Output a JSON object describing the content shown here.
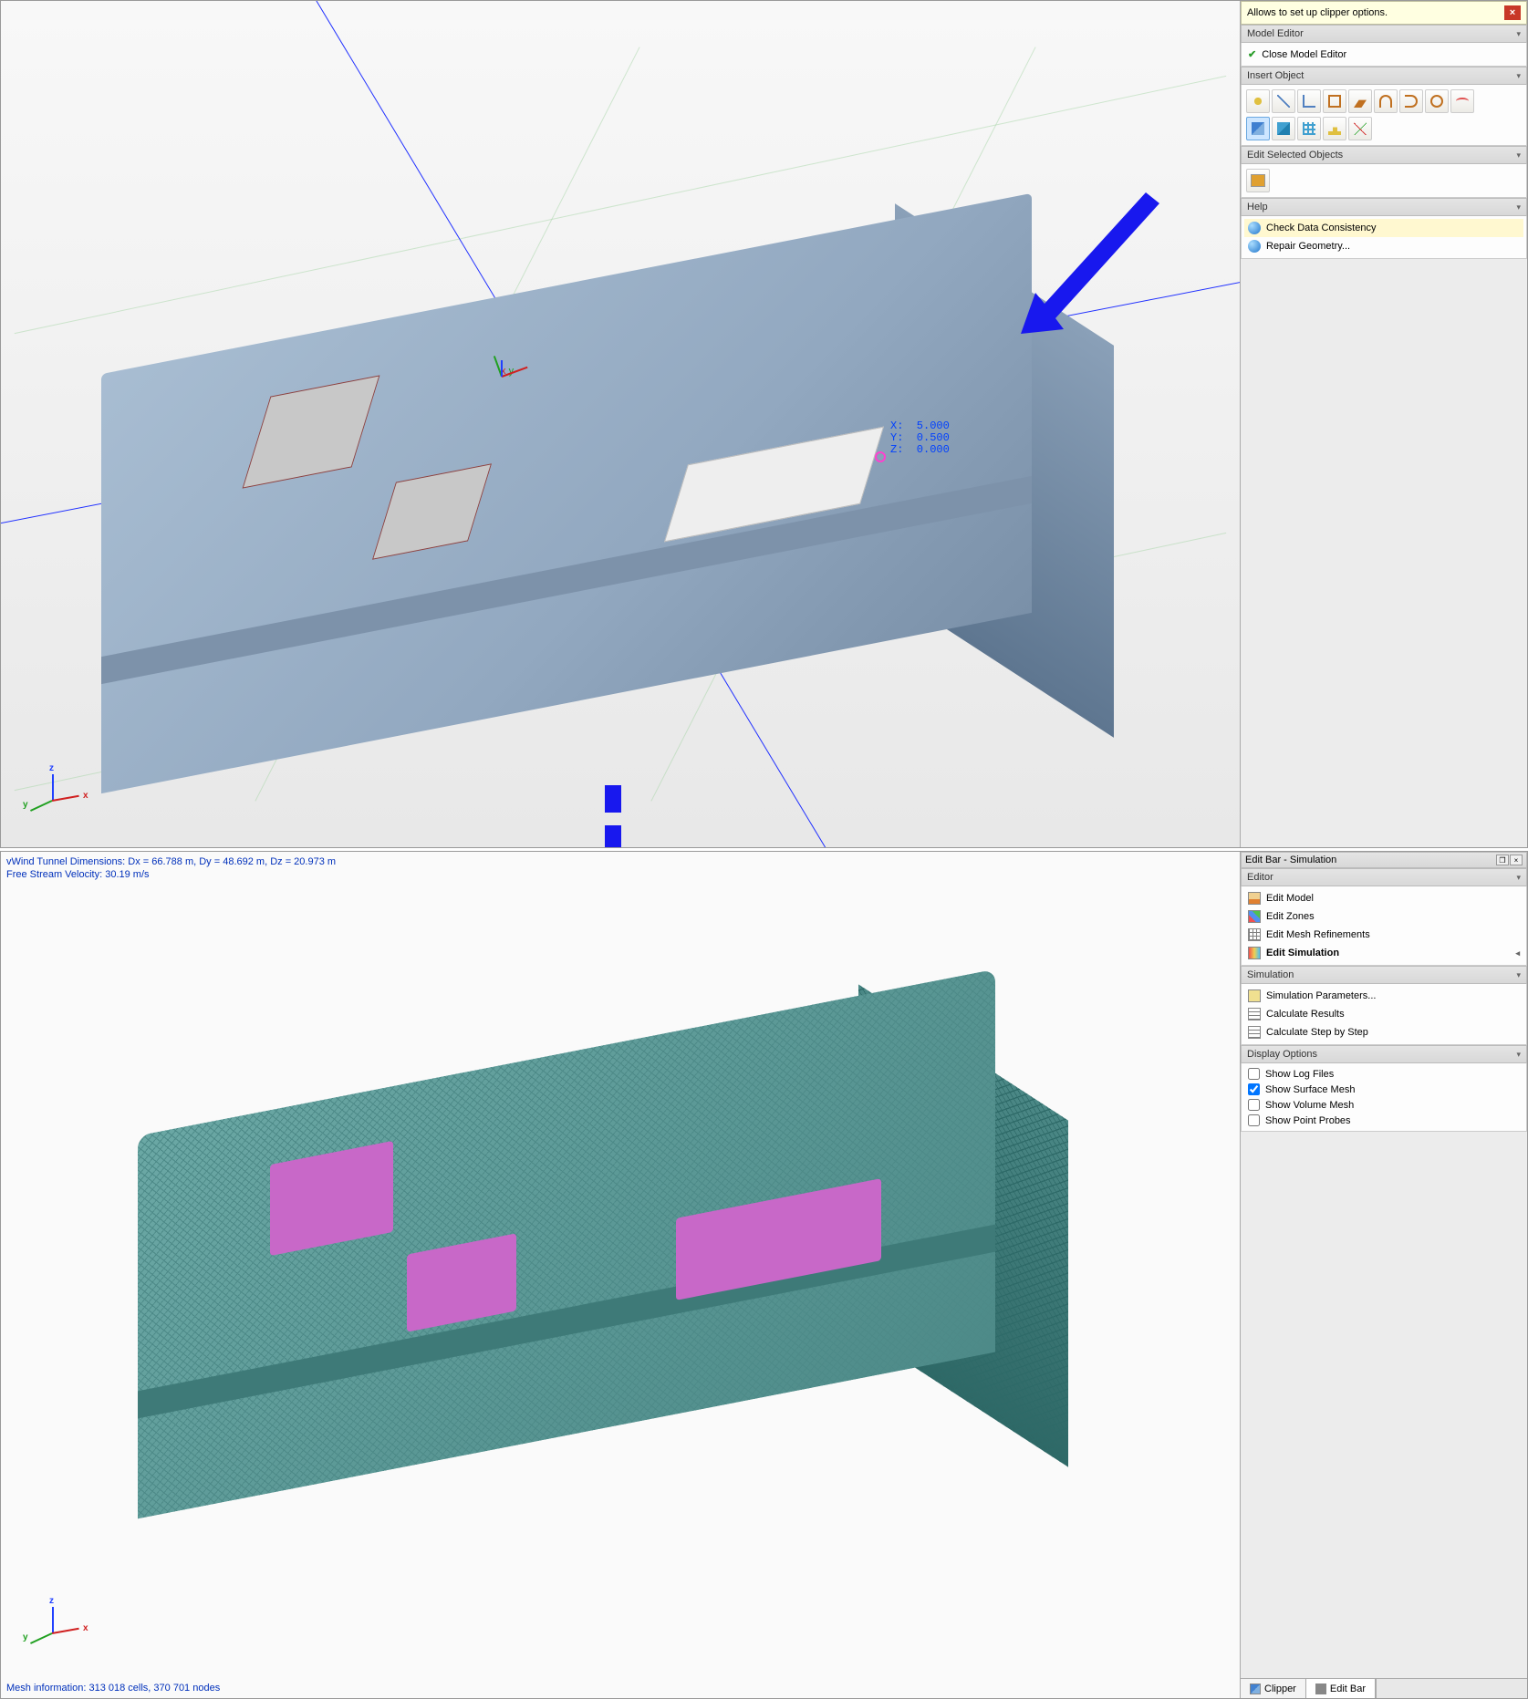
{
  "top": {
    "tooltip": "Allows to set up clipper options.",
    "panels": {
      "model_editor": {
        "title": "Model Editor",
        "close_label": "Close Model Editor"
      },
      "insert_object": {
        "title": "Insert Object"
      },
      "edit_selected": {
        "title": "Edit Selected Objects"
      },
      "help": {
        "title": "Help",
        "items": [
          "Check Data Consistency",
          "Repair Geometry..."
        ]
      }
    },
    "coord_readout": "X:  5.000\nY:  0.500\nZ:  0.000",
    "triad_labels": {
      "x": "x",
      "y": "y",
      "z": "z"
    }
  },
  "bottom": {
    "titlebar": "Edit Bar - Simulation",
    "panels": {
      "editor": {
        "title": "Editor",
        "items": [
          "Edit Model",
          "Edit Zones",
          "Edit Mesh Refinements",
          "Edit Simulation"
        ]
      },
      "simulation": {
        "title": "Simulation",
        "items": [
          "Simulation Parameters...",
          "Calculate Results",
          "Calculate Step by Step"
        ]
      },
      "display": {
        "title": "Display Options",
        "items": [
          {
            "label": "Show Log Files",
            "checked": false
          },
          {
            "label": "Show Surface Mesh",
            "checked": true
          },
          {
            "label": "Show Volume Mesh",
            "checked": false
          },
          {
            "label": "Show Point Probes",
            "checked": false
          }
        ]
      }
    },
    "status_top": "vWind Tunnel Dimensions: Dx = 66.788 m, Dy = 48.692 m, Dz = 20.973 m\nFree Stream Velocity: 30.19 m/s",
    "status_bottom": "Mesh information: 313 018 cells, 370 701 nodes",
    "tabs": [
      "Clipper",
      "Edit Bar"
    ],
    "triad_labels": {
      "x": "x",
      "y": "y",
      "z": "z"
    }
  }
}
